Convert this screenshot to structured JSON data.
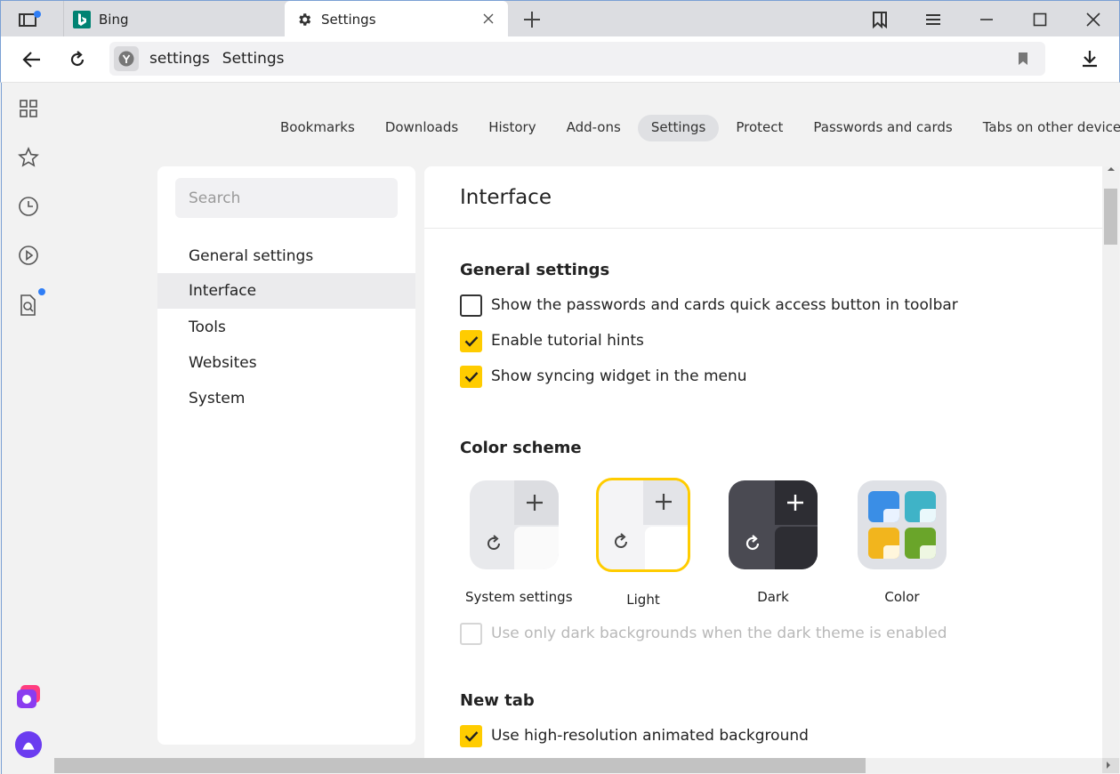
{
  "tabs": [
    {
      "title": "Bing",
      "icon": "bing-icon"
    },
    {
      "title": "Settings",
      "icon": "gear-icon"
    }
  ],
  "address": {
    "url": "settings",
    "page_title": "Settings"
  },
  "page_nav": [
    "Bookmarks",
    "Downloads",
    "History",
    "Add-ons",
    "Settings",
    "Protect",
    "Passwords and cards",
    "Tabs on other devices"
  ],
  "page_nav_active": "Settings",
  "search": {
    "placeholder": "Search"
  },
  "left_menu": [
    "General settings",
    "Interface",
    "Tools",
    "Websites",
    "System"
  ],
  "left_menu_active": "Interface",
  "main": {
    "title": "Interface",
    "general": {
      "title": "General settings",
      "options": [
        {
          "label": "Show the passwords and cards quick access button in toolbar",
          "checked": false
        },
        {
          "label": "Enable tutorial hints",
          "checked": true
        },
        {
          "label": "Show syncing widget in the menu",
          "checked": true
        }
      ]
    },
    "color_scheme": {
      "title": "Color scheme",
      "options": [
        "System settings",
        "Light",
        "Dark",
        "Color"
      ],
      "selected": "Light",
      "dark_bg_option": {
        "label": "Use only dark backgrounds when the dark theme is enabled",
        "checked": false,
        "disabled": true
      }
    },
    "new_tab": {
      "title": "New tab",
      "options": [
        {
          "label": "Use high-resolution animated background",
          "checked": true
        }
      ]
    }
  },
  "colors": {
    "accent": "#ffcc00",
    "notification_dot": "#2f7ef6",
    "alice": "#6b3cf0"
  }
}
